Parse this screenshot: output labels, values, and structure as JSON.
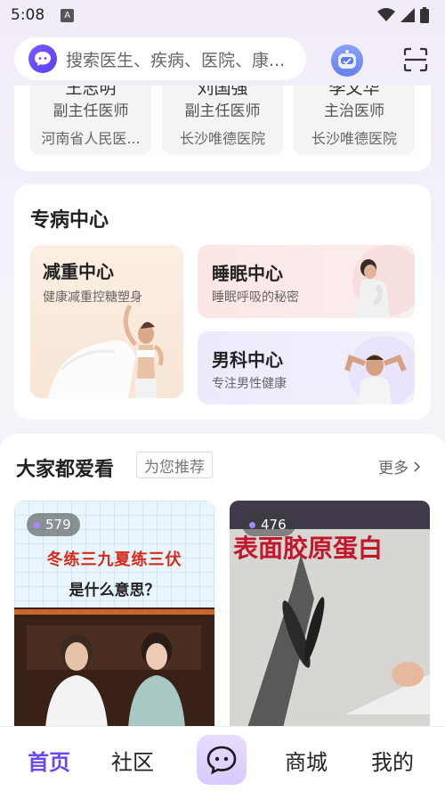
{
  "status_bar": {
    "time": "5:08",
    "notification_glyph": "A"
  },
  "search": {
    "placeholder": "搜索医生、疾病、医院、康..."
  },
  "doctors": [
    {
      "name": "王志明",
      "title": "副主任医师",
      "hospital": "河南省人民医..."
    },
    {
      "name": "刘国强",
      "title": "副主任医师",
      "hospital": "长沙唯德医院"
    },
    {
      "name": "李文华",
      "title": "主治医师",
      "hospital": "长沙唯德医院"
    }
  ],
  "special_center": {
    "title": "专病中心",
    "tiles": [
      {
        "title": "减重中心",
        "subtitle": "健康减重控糖塑身"
      },
      {
        "title": "睡眠中心",
        "subtitle": "睡眠呼吸的秘密"
      },
      {
        "title": "男科中心",
        "subtitle": "专注男性健康"
      }
    ]
  },
  "recommend": {
    "title": "大家都爱看",
    "badge": "为您推荐",
    "more": "更多",
    "videos": [
      {
        "count": "579",
        "caption_line1": "冬练三九夏练三伏",
        "caption_line2": "是什么意思？"
      },
      {
        "count": "476",
        "caption_line1": "表面胶原蛋白",
        "caption_line2": ""
      }
    ]
  },
  "nav": {
    "home": "首页",
    "community": "社区",
    "mall": "商城",
    "mine": "我的"
  },
  "colors": {
    "accent": "#6a48f0",
    "caption_red": "#d62a1c"
  }
}
